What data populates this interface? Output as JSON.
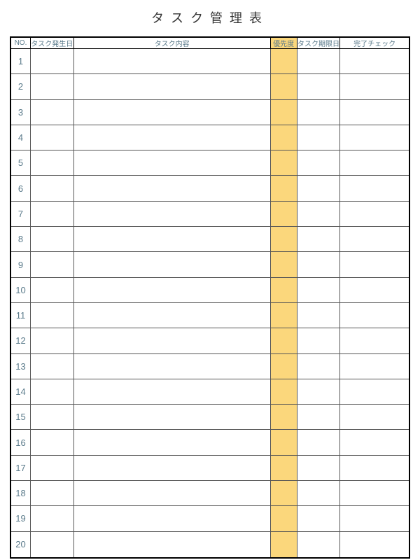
{
  "title": "タスク管理表",
  "columns": {
    "no": "NO.",
    "created": "タスク発生日",
    "task": "タスク内容",
    "priority": "優先度",
    "due": "タスク期限日",
    "done": "完了チェック"
  },
  "highlight_color": "#fbd77c",
  "rows": [
    {
      "no": "1",
      "created": "",
      "task": "",
      "priority": "",
      "due": "",
      "done": ""
    },
    {
      "no": "2",
      "created": "",
      "task": "",
      "priority": "",
      "due": "",
      "done": ""
    },
    {
      "no": "3",
      "created": "",
      "task": "",
      "priority": "",
      "due": "",
      "done": ""
    },
    {
      "no": "4",
      "created": "",
      "task": "",
      "priority": "",
      "due": "",
      "done": ""
    },
    {
      "no": "5",
      "created": "",
      "task": "",
      "priority": "",
      "due": "",
      "done": ""
    },
    {
      "no": "6",
      "created": "",
      "task": "",
      "priority": "",
      "due": "",
      "done": ""
    },
    {
      "no": "7",
      "created": "",
      "task": "",
      "priority": "",
      "due": "",
      "done": ""
    },
    {
      "no": "8",
      "created": "",
      "task": "",
      "priority": "",
      "due": "",
      "done": ""
    },
    {
      "no": "9",
      "created": "",
      "task": "",
      "priority": "",
      "due": "",
      "done": ""
    },
    {
      "no": "10",
      "created": "",
      "task": "",
      "priority": "",
      "due": "",
      "done": ""
    },
    {
      "no": "11",
      "created": "",
      "task": "",
      "priority": "",
      "due": "",
      "done": ""
    },
    {
      "no": "12",
      "created": "",
      "task": "",
      "priority": "",
      "due": "",
      "done": ""
    },
    {
      "no": "13",
      "created": "",
      "task": "",
      "priority": "",
      "due": "",
      "done": ""
    },
    {
      "no": "14",
      "created": "",
      "task": "",
      "priority": "",
      "due": "",
      "done": ""
    },
    {
      "no": "15",
      "created": "",
      "task": "",
      "priority": "",
      "due": "",
      "done": ""
    },
    {
      "no": "16",
      "created": "",
      "task": "",
      "priority": "",
      "due": "",
      "done": ""
    },
    {
      "no": "17",
      "created": "",
      "task": "",
      "priority": "",
      "due": "",
      "done": ""
    },
    {
      "no": "18",
      "created": "",
      "task": "",
      "priority": "",
      "due": "",
      "done": ""
    },
    {
      "no": "19",
      "created": "",
      "task": "",
      "priority": "",
      "due": "",
      "done": ""
    },
    {
      "no": "20",
      "created": "",
      "task": "",
      "priority": "",
      "due": "",
      "done": ""
    }
  ]
}
